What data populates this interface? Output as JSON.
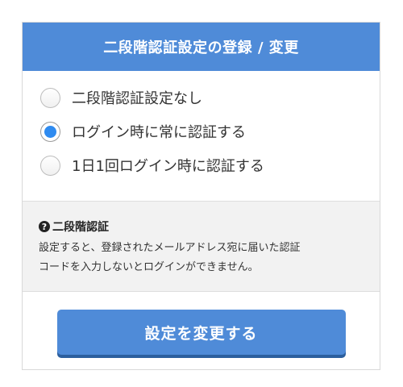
{
  "header": {
    "title": "二段階認証設定の登録 / 変更"
  },
  "options": [
    {
      "label": "二段階認証設定なし",
      "checked": false
    },
    {
      "label": "ログイン時に常に認証する",
      "checked": true
    },
    {
      "label": "1日1回ログイン時に認証する",
      "checked": false
    }
  ],
  "info": {
    "icon": "question-circle-icon",
    "title": "二段階認証",
    "line1": "設定すると、登録されたメールアドレス宛に届いた認証",
    "line2": "コードを入力しないとログインができません。"
  },
  "submit": {
    "label": "設定を変更する"
  },
  "colors": {
    "primary": "#4f8bd8",
    "radio_selected": "#2f8bf0",
    "info_background": "#f2f2f2"
  }
}
